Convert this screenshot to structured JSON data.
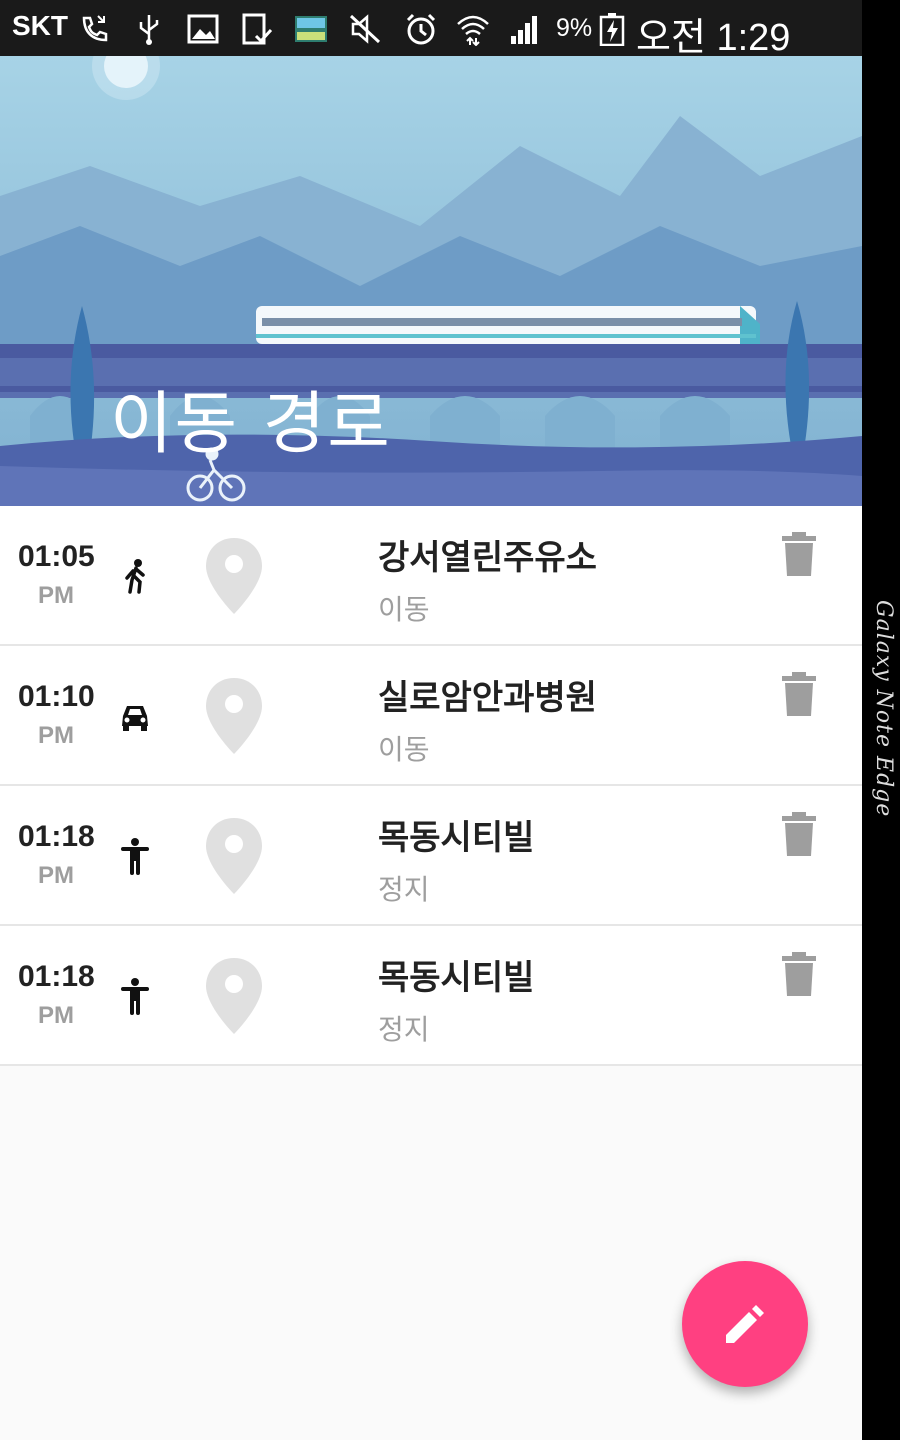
{
  "status_bar": {
    "carrier": "SKT",
    "battery_percent": "9%",
    "time": "오전 1:29",
    "icons": [
      "phone-missed-icon",
      "usb-icon",
      "image-icon",
      "tablet-check-icon",
      "photo-icon",
      "mute-icon",
      "alarm-icon",
      "wifi-icon",
      "signal-icon",
      "battery-charging-icon"
    ]
  },
  "header": {
    "title": "이동 경로"
  },
  "timeline": [
    {
      "time": "01:05",
      "ampm": "PM",
      "activity_icon": "walking-icon",
      "place": "강서열린주유소",
      "status": "이동"
    },
    {
      "time": "01:10",
      "ampm": "PM",
      "activity_icon": "car-icon",
      "place": "실로암안과병원",
      "status": "이동"
    },
    {
      "time": "01:18",
      "ampm": "PM",
      "activity_icon": "standing-icon",
      "place": "목동시티빌",
      "status": "정지"
    },
    {
      "time": "01:18",
      "ampm": "PM",
      "activity_icon": "standing-icon",
      "place": "목동시티빌",
      "status": "정지"
    }
  ],
  "fab": {
    "icon": "edit-icon",
    "color": "#ff4081"
  },
  "edge_label": "Galaxy Note Edge"
}
